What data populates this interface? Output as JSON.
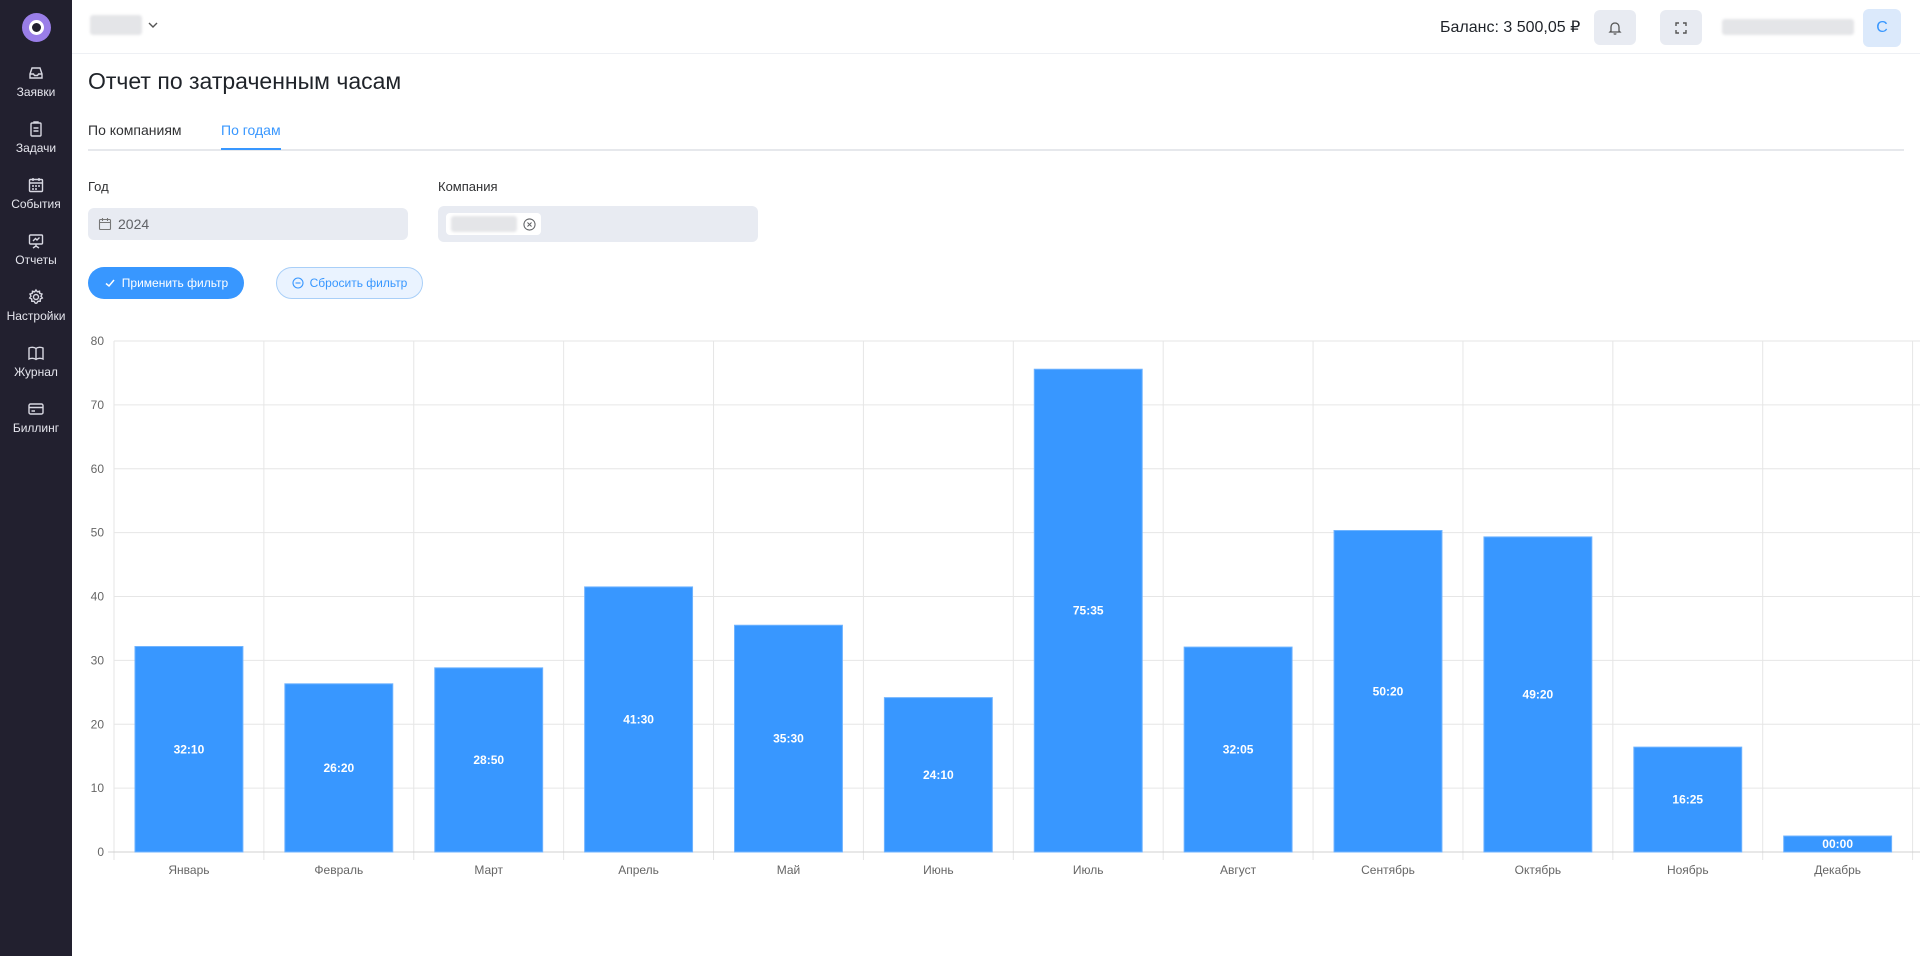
{
  "sidebar": {
    "items": [
      {
        "label": "Заявки",
        "icon": "inbox-icon"
      },
      {
        "label": "Задачи",
        "icon": "clipboard-icon"
      },
      {
        "label": "События",
        "icon": "calendar-icon"
      },
      {
        "label": "Отчеты",
        "icon": "presentation-icon"
      },
      {
        "label": "Настройки",
        "icon": "gear-icon"
      },
      {
        "label": "Журнал",
        "icon": "book-icon"
      },
      {
        "label": "Биллинг",
        "icon": "card-icon"
      }
    ]
  },
  "header": {
    "balance": "Баланс: 3 500,05 ₽",
    "avatar_letter": "С"
  },
  "page": {
    "title": "Отчет по затраченным часам",
    "tabs": [
      {
        "label": "По компаниям",
        "active": false
      },
      {
        "label": "По годам",
        "active": true
      }
    ]
  },
  "filters": {
    "year_label": "Год",
    "year_value": "2024",
    "company_label": "Компания",
    "apply_label": "Применить фильтр",
    "reset_label": "Сбросить фильтр"
  },
  "colors": {
    "accent": "#3897ff",
    "sidebar": "#22202f",
    "bar": "#3897ff"
  },
  "chart_data": {
    "type": "bar",
    "categories": [
      "Январь",
      "Февраль",
      "Март",
      "Апрель",
      "Май",
      "Июнь",
      "Июль",
      "Август",
      "Сентябрь",
      "Октябрь",
      "Ноябрь",
      "Декабрь"
    ],
    "values": [
      32.17,
      26.33,
      28.83,
      41.5,
      35.5,
      24.17,
      75.58,
      32.08,
      50.33,
      49.33,
      16.42,
      2.5
    ],
    "data_labels": [
      "32:10",
      "26:20",
      "28:50",
      "41:30",
      "35:30",
      "24:10",
      "75:35",
      "32:05",
      "50:20",
      "49:20",
      "16:25",
      "00:00"
    ],
    "yticks": [
      0,
      10,
      20,
      30,
      40,
      50,
      60,
      70,
      80
    ],
    "ylim": [
      0,
      80
    ],
    "grid": true,
    "title": "",
    "xlabel": "",
    "ylabel": ""
  }
}
